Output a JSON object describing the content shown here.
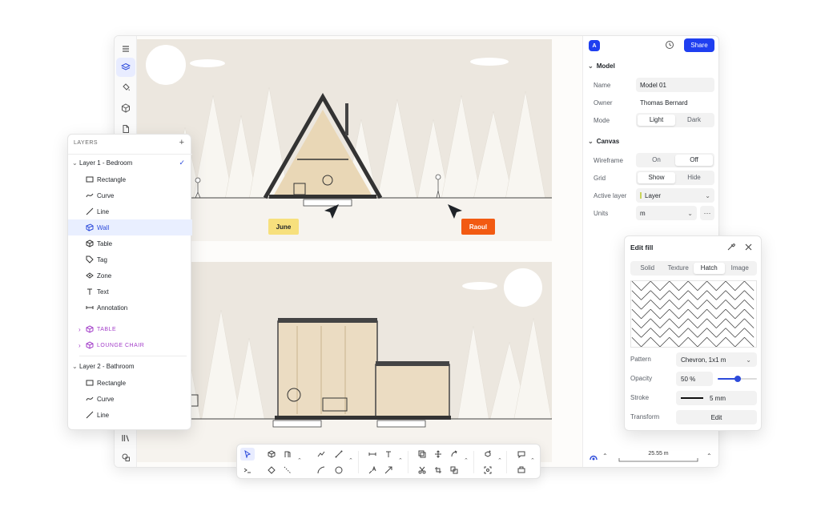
{
  "header": {
    "avatar_letter": "A",
    "share_label": "Share"
  },
  "left_toolbar": {
    "icons": [
      "menu-icon",
      "layers-icon",
      "paint-bucket-icon",
      "cube-icon",
      "page-icon",
      "library-icon",
      "assets-icon"
    ]
  },
  "canvas": {
    "cursors": [
      {
        "name": "June",
        "color": "#f7e07d"
      },
      {
        "name": "Raoul",
        "color": "#f25a12"
      }
    ]
  },
  "layers_panel": {
    "title": "LAYERS",
    "add_icon": "plus-icon",
    "groups": [
      {
        "label": "Layer 1 - Bedroom",
        "checked": true,
        "items": [
          {
            "label": "Rectangle",
            "icon": "rectangle-icon"
          },
          {
            "label": "Curve",
            "icon": "curve-icon"
          },
          {
            "label": "Line",
            "icon": "line-icon"
          },
          {
            "label": "Wall",
            "icon": "wall-icon",
            "selected": true
          },
          {
            "label": "Table",
            "icon": "table-icon"
          },
          {
            "label": "Tag",
            "icon": "tag-icon"
          },
          {
            "label": "Zone",
            "icon": "zone-icon"
          },
          {
            "label": "Text",
            "icon": "text-icon"
          },
          {
            "label": "Annotation",
            "icon": "annotation-icon"
          }
        ],
        "components": [
          "TABLE",
          "LOUNGE CHAIR"
        ]
      },
      {
        "label": "Layer 2 - Bathroom",
        "items": [
          {
            "label": "Rectangle",
            "icon": "rectangle-icon"
          },
          {
            "label": "Curve",
            "icon": "curve-icon"
          },
          {
            "label": "Line",
            "icon": "line-icon"
          }
        ]
      }
    ]
  },
  "properties": {
    "model_section": "Model",
    "name_label": "Name",
    "name_value": "Model 01",
    "owner_label": "Owner",
    "owner_value": "Thomas Bernard",
    "mode_label": "Mode",
    "mode_options": [
      "Light",
      "Dark"
    ],
    "mode_selected": "Light",
    "canvas_section": "Canvas",
    "wireframe_label": "Wireframe",
    "wireframe_options": [
      "On",
      "Off"
    ],
    "wireframe_selected": "Off",
    "grid_label": "Grid",
    "grid_options": [
      "Show",
      "Hide"
    ],
    "grid_selected": "Show",
    "active_layer_label": "Active layer",
    "active_layer_value": "Layer",
    "units_label": "Units",
    "units_value": "m"
  },
  "edit_fill": {
    "title": "Edit fill",
    "tabs": [
      "Solid",
      "Texture",
      "Hatch",
      "Image"
    ],
    "active_tab": "Hatch",
    "pattern_label": "Pattern",
    "pattern_value": "Chevron, 1x1 m",
    "opacity_label": "Opacity",
    "opacity_value": "50 %",
    "opacity_level": 0.5,
    "stroke_label": "Stroke",
    "stroke_value": "5 mm",
    "transform_label": "Transform",
    "transform_button": "Edit"
  },
  "status": {
    "scale_value": "25.55 m"
  },
  "colors": {
    "accent": "#1f3ff0",
    "selection_bg": "#e9efff",
    "component": "#a33ec9",
    "scene_bg": "#efebe4"
  }
}
